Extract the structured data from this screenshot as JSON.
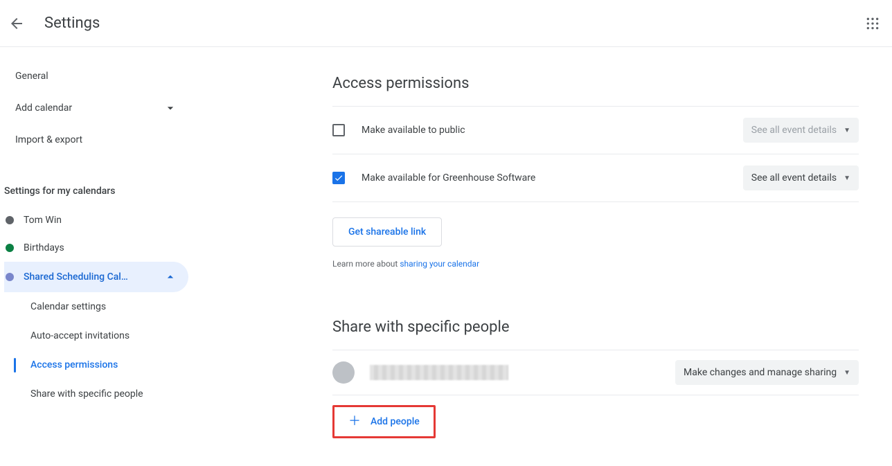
{
  "header": {
    "title": "Settings"
  },
  "sidebar": {
    "general": "General",
    "add_calendar": "Add calendar",
    "import_export": "Import & export",
    "section_label": "Settings for my calendars",
    "calendars": [
      {
        "label": "Tom Win",
        "color": "#5f6368"
      },
      {
        "label": "Birthdays",
        "color": "#0b8043"
      },
      {
        "label": "Shared Scheduling Cal…",
        "color": "#7986cb",
        "selected": true
      }
    ],
    "sub_items": [
      {
        "label": "Calendar settings",
        "active": false
      },
      {
        "label": "Auto-accept invitations",
        "active": false
      },
      {
        "label": "Access permissions",
        "active": true
      },
      {
        "label": "Share with specific people",
        "active": false
      }
    ]
  },
  "access": {
    "heading": "Access permissions",
    "row1_label": "Make available to public",
    "row1_dropdown": "See all event details",
    "row2_label": "Make available for Greenhouse Software",
    "row2_dropdown": "See all event details",
    "link_button": "Get shareable link",
    "help_prefix": "Learn more about ",
    "help_link": "sharing your calendar"
  },
  "share": {
    "heading": "Share with specific people",
    "person_permission": "Make changes and manage sharing",
    "add_button": "Add people"
  }
}
